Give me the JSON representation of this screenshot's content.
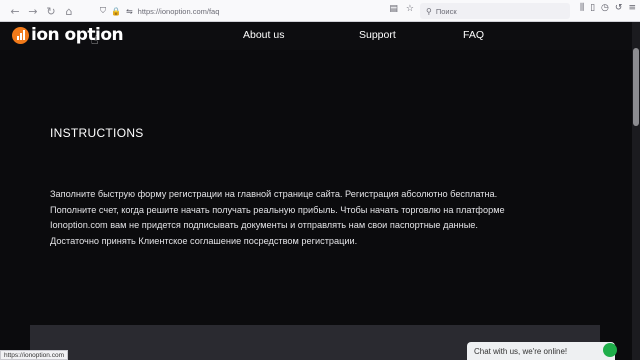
{
  "browser": {
    "url": "https://ionoption.com/faq",
    "search_placeholder": "Поиск",
    "status_url": "https://ionoption.com"
  },
  "header": {
    "logo_text": "ion option",
    "nav": [
      "About us",
      "Support",
      "FAQ"
    ]
  },
  "main": {
    "heading": "INSTRUCTIONS",
    "paragraph": "Заполните быструю форму регистрации на главной странице сайта. Регистрация абсолютно бесплатна. Пополните счет, когда решите начать получать реальную прибыль. Чтобы начать торговлю на платформе Ionoption.com вам не придется подписывать документы и отправлять нам свои паспортные данные. Достаточно принять Клиентское соглашение посредством регистрации."
  },
  "chat": {
    "label": "Chat with us, we're online!"
  },
  "colors": {
    "brand_orange": "#f27a1a",
    "background": "#0b0b0d",
    "chat_status": "#1fae4a"
  }
}
